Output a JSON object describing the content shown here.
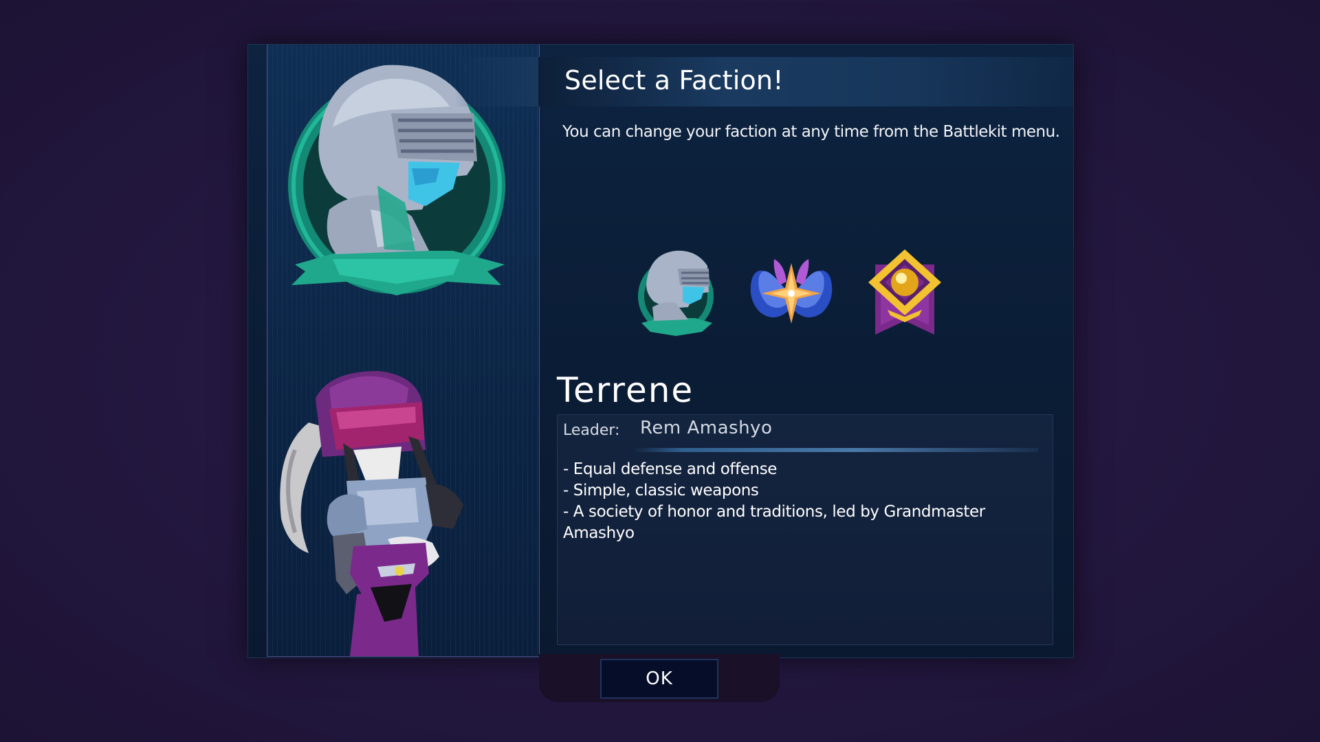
{
  "dialog": {
    "title": "Select a Faction!",
    "subtitle": "You can change your faction at any time from the Battlekit menu."
  },
  "faction_icons": [
    {
      "name": "terrene-knight-icon",
      "selected": true
    },
    {
      "name": "winged-star-icon",
      "selected": false
    },
    {
      "name": "golden-orb-banner-icon",
      "selected": false
    }
  ],
  "faction": {
    "name": "Terrene",
    "leader_label": "Leader:",
    "leader_name": "Rem Amashyo",
    "traits": [
      "- Equal defense and offense",
      "- Simple, classic weapons",
      "- A society of honor and traditions, led by Grandmaster Amashyo"
    ]
  },
  "ok_button": {
    "label": "OK"
  },
  "colors": {
    "background": "#23173f",
    "panel": "#0b1d36",
    "accent_teal": "#1fa88c",
    "accent_purple": "#7b2a8c",
    "button_bg": "#060d28"
  }
}
